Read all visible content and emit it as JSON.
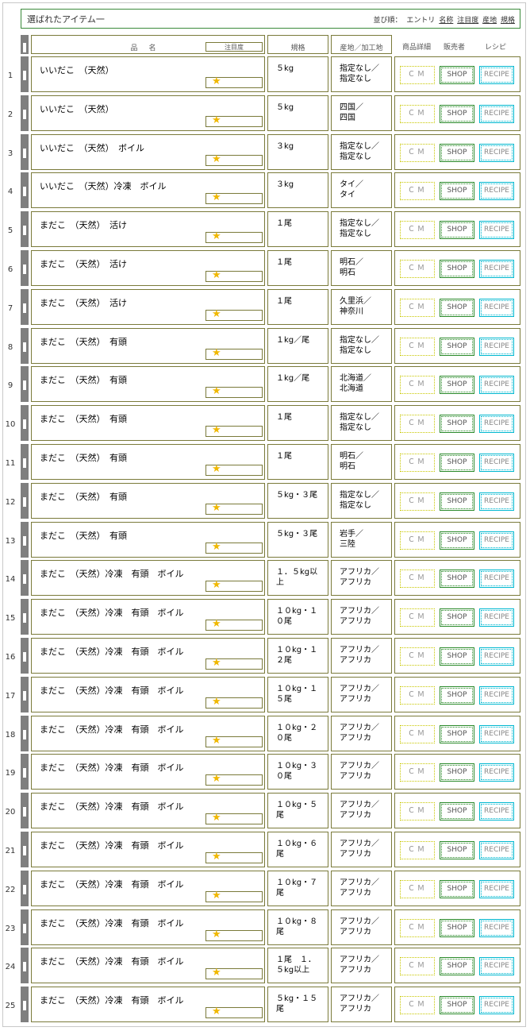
{
  "header": {
    "title": "選ばれたアイテム一",
    "sort_label": "並び順：",
    "sort_options": [
      "エントリ",
      "名称",
      "注目度",
      "産地",
      "規格"
    ]
  },
  "columns": {
    "name": "品名",
    "attention": "注目度",
    "spec": "規格",
    "origin": "産地／加工地",
    "details": "商品詳細",
    "seller": "販売者",
    "recipe": "レシピ"
  },
  "buttons": {
    "cm": "ＣＭ",
    "shop": "SHOP",
    "recipe": "RECIPE"
  },
  "star_glyph": "★",
  "rows": [
    {
      "num": "1",
      "name": "いいだこ　（天然）",
      "spec": "５kg",
      "origin": "指定なし／\n指定なし"
    },
    {
      "num": "2",
      "name": "いいだこ　（天然）",
      "spec": "５kg",
      "origin": "四国／\n四国"
    },
    {
      "num": "3",
      "name": "いいだこ　（天然）　ボイル",
      "spec": "３kg",
      "origin": "指定なし／\n指定なし"
    },
    {
      "num": "4",
      "name": "いいだこ　（天然）冷凍　ボイル",
      "spec": "３kg",
      "origin": "タイ／\nタイ"
    },
    {
      "num": "5",
      "name": "まだこ　（天然）　活け",
      "spec": "１尾",
      "origin": "指定なし／\n指定なし"
    },
    {
      "num": "6",
      "name": "まだこ　（天然）　活け",
      "spec": "１尾",
      "origin": "明石／\n明石"
    },
    {
      "num": "7",
      "name": "まだこ　（天然）　活け",
      "spec": "１尾",
      "origin": "久里浜／\n神奈川"
    },
    {
      "num": "8",
      "name": "まだこ　（天然）　有頭",
      "spec": "１kg／尾",
      "origin": "指定なし／\n指定なし"
    },
    {
      "num": "9",
      "name": "まだこ　（天然）　有頭",
      "spec": "１kg／尾",
      "origin": "北海道／\n北海道"
    },
    {
      "num": "10",
      "name": "まだこ　（天然）　有頭",
      "spec": "１尾",
      "origin": "指定なし／\n指定なし"
    },
    {
      "num": "11",
      "name": "まだこ　（天然）　有頭",
      "spec": "１尾",
      "origin": "明石／\n明石"
    },
    {
      "num": "12",
      "name": "まだこ　（天然）　有頭",
      "spec": "５kg・３尾",
      "origin": "指定なし／\n指定なし"
    },
    {
      "num": "13",
      "name": "まだこ　（天然）　有頭",
      "spec": "５kg・３尾",
      "origin": "岩手／\n三陸"
    },
    {
      "num": "14",
      "name": "まだこ　（天然）冷凍　有頭　ボイル",
      "spec": "１．５kg以\n上",
      "origin": "アフリカ／\nアフリカ"
    },
    {
      "num": "15",
      "name": "まだこ　（天然）冷凍　有頭　ボイル",
      "spec": "１０kg・１\n０尾",
      "origin": "アフリカ／\nアフリカ"
    },
    {
      "num": "16",
      "name": "まだこ　（天然）冷凍　有頭　ボイル",
      "spec": "１０kg・１\n２尾",
      "origin": "アフリカ／\nアフリカ"
    },
    {
      "num": "17",
      "name": "まだこ　（天然）冷凍　有頭　ボイル",
      "spec": "１０kg・１\n５尾",
      "origin": "アフリカ／\nアフリカ"
    },
    {
      "num": "18",
      "name": "まだこ　（天然）冷凍　有頭　ボイル",
      "spec": "１０kg・２\n０尾",
      "origin": "アフリカ／\nアフリカ"
    },
    {
      "num": "19",
      "name": "まだこ　（天然）冷凍　有頭　ボイル",
      "spec": "１０kg・３\n０尾",
      "origin": "アフリカ／\nアフリカ"
    },
    {
      "num": "20",
      "name": "まだこ　（天然）冷凍　有頭　ボイル",
      "spec": "１０kg・５\n尾",
      "origin": "アフリカ／\nアフリカ"
    },
    {
      "num": "21",
      "name": "まだこ　（天然）冷凍　有頭　ボイル",
      "spec": "１０kg・６\n尾",
      "origin": "アフリカ／\nアフリカ"
    },
    {
      "num": "22",
      "name": "まだこ　（天然）冷凍　有頭　ボイル",
      "spec": "１０kg・７\n尾",
      "origin": "アフリカ／\nアフリカ"
    },
    {
      "num": "23",
      "name": "まだこ　（天然）冷凍　有頭　ボイル",
      "spec": "１０kg・８\n尾",
      "origin": "アフリカ／\nアフリカ"
    },
    {
      "num": "24",
      "name": "まだこ　（天然）冷凍　有頭　ボイル",
      "spec": "１尾　１．\n５kg以上",
      "origin": "アフリカ／\nアフリカ"
    },
    {
      "num": "25",
      "name": "まだこ　（天然）冷凍　有頭　ボイル",
      "spec": "５kg・１５\n尾",
      "origin": "アフリカ／\nアフリカ"
    }
  ]
}
